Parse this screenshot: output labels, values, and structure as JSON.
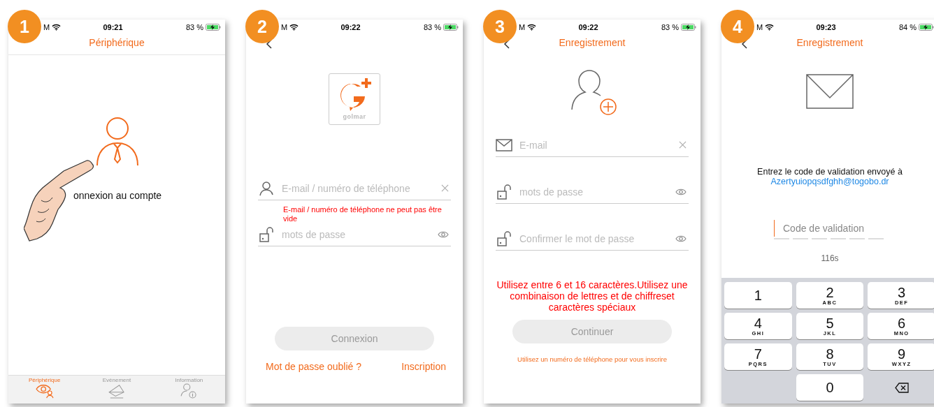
{
  "screens": [
    {
      "badge": "1",
      "kind": "devices",
      "status": {
        "carrier": "M",
        "time": "09:21",
        "battery": "83 %"
      },
      "title": "Périphérique",
      "account_label": "onnexion au compte",
      "tabs": [
        {
          "label": "Périphérique",
          "selected": true
        },
        {
          "label": "Evènement",
          "selected": false
        },
        {
          "label": "Information",
          "selected": false
        }
      ]
    },
    {
      "badge": "2",
      "kind": "login",
      "status": {
        "carrier": "M",
        "time": "09:22",
        "battery": "83 %"
      },
      "logo_text": "golmar",
      "fields": [
        {
          "kind": "account",
          "placeholder": "E-mail / numéro de téléphone",
          "error": "E-mail / numéro de téléphone ne peut pas être vide"
        },
        {
          "kind": "password",
          "placeholder": "mots de passe"
        }
      ],
      "button": {
        "label": "Connexion",
        "disabled": true
      },
      "links": [
        "Mot de passe oublié ?",
        "Inscription"
      ]
    },
    {
      "badge": "3",
      "kind": "register",
      "status": {
        "carrier": "M",
        "time": "09:22",
        "battery": "83 %"
      },
      "title": "Enregistrement",
      "fields": [
        {
          "kind": "email",
          "placeholder": "E-mail"
        },
        {
          "kind": "password",
          "placeholder": "mots de passe"
        },
        {
          "kind": "password",
          "placeholder": "Confirmer le mot de passe"
        }
      ],
      "hint": "Utilisez entre 6 et 16 caractères.Utilisez une combinaison de lettres et de chiffreset caractères spéciaux",
      "button": {
        "label": "Continuer",
        "disabled": true
      },
      "link": "Utilisez un numéro de téléphone pour vous inscrire"
    },
    {
      "badge": "4",
      "kind": "validate",
      "status": {
        "carrier": "M",
        "time": "09:23",
        "battery": "84 %"
      },
      "title": "Enregistrement",
      "message": "Entrez le code de validation envoyé à",
      "email": "Azertyuiopqsdfghh@togobo.dr",
      "code_placeholder": "Code de validation",
      "countdown": "116s",
      "keys": [
        {
          "kind": "digit",
          "digit": "1"
        },
        {
          "kind": "digit",
          "digit": "2",
          "letters": "ABC"
        },
        {
          "kind": "digit",
          "digit": "3",
          "letters": "DEF"
        },
        {
          "kind": "digit",
          "digit": "4",
          "letters": "GHI"
        },
        {
          "kind": "digit",
          "digit": "5",
          "letters": "JKL"
        },
        {
          "kind": "digit",
          "digit": "6",
          "letters": "MNO"
        },
        {
          "kind": "digit",
          "digit": "7",
          "letters": "PQRS"
        },
        {
          "kind": "digit",
          "digit": "8",
          "letters": "TUV"
        },
        {
          "kind": "digit",
          "digit": "9",
          "letters": "WXYZ"
        },
        {
          "kind": "blank"
        },
        {
          "kind": "digit",
          "digit": "0"
        },
        {
          "kind": "delete"
        }
      ]
    }
  ]
}
